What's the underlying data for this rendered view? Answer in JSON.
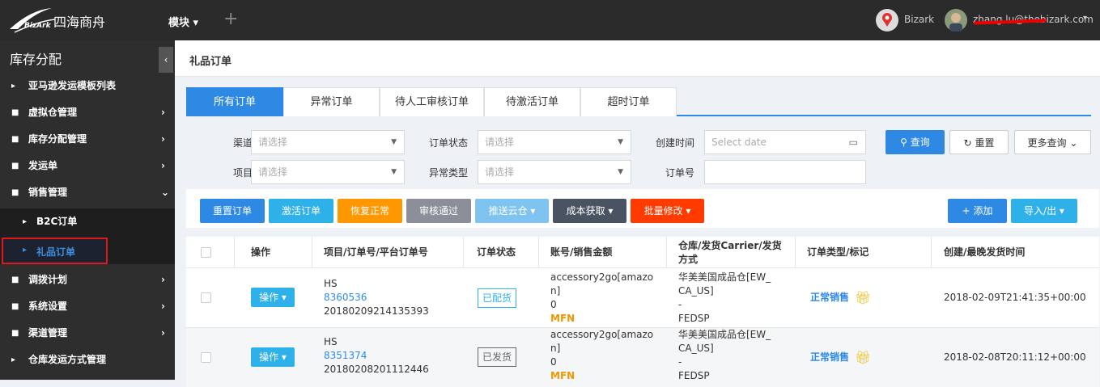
{
  "header": {
    "logo_text": "四海商舟",
    "logo_sub": "BizArk",
    "module_label": "模块",
    "plus_label": "+",
    "user1_name": "Bizark",
    "user2_email": "zhang.lu@thebizark.com"
  },
  "sidebar": {
    "title": "库存分配",
    "toggle": "‹",
    "items": [
      {
        "label": "亚马逊发运模板列表",
        "icon": "caret-right-icon",
        "arrow": ""
      },
      {
        "label": "虚拟仓管理",
        "icon": "folder-icon",
        "arrow": "›"
      },
      {
        "label": "库存分配管理",
        "icon": "folder-icon",
        "arrow": "›"
      },
      {
        "label": "发运单",
        "icon": "folder-icon",
        "arrow": "›"
      },
      {
        "label": "销售管理",
        "icon": "folder-icon",
        "arrow": "⌄"
      },
      {
        "label": "B2C订单",
        "icon": "caret-right-icon",
        "arrow": ""
      },
      {
        "label": "礼品订单",
        "icon": "caret-right-icon",
        "arrow": ""
      },
      {
        "label": "调拨计划",
        "icon": "folder-icon",
        "arrow": "›"
      },
      {
        "label": "系统设置",
        "icon": "folder-icon",
        "arrow": "›"
      },
      {
        "label": "渠道管理",
        "icon": "folder-icon",
        "arrow": "›"
      },
      {
        "label": "仓库发运方式管理",
        "icon": "caret-right-icon",
        "arrow": ""
      }
    ]
  },
  "page": {
    "title": "礼品订单"
  },
  "tabs": [
    "所有订单",
    "异常订单",
    "待人工审核订单",
    "待激活订单",
    "超时订单"
  ],
  "filters": {
    "channel_label": "渠道",
    "status_label": "订单状态",
    "created_label": "创建时间",
    "project_label": "项目",
    "exception_label": "异常类型",
    "order_no_label": "订单号",
    "select_placeholder": "请选择",
    "date_placeholder": "Select date",
    "search_btn": "查询",
    "reset_btn": "重置",
    "more_btn": "更多查询"
  },
  "toolbar": {
    "buttons": [
      "重置订单",
      "激活订单",
      "恢复正常",
      "审核通过",
      "推送云仓",
      "成本获取",
      "批量修改"
    ],
    "add_btn": "添加",
    "import_btn": "导入/出"
  },
  "colors": {
    "primary": "#2e89e5",
    "cyan": "#2eb0e8",
    "orange": "#ff9700",
    "gray": "#8a8f99",
    "dark": "#4a5361",
    "red": "#ff3b00"
  },
  "table": {
    "headers": [
      "操作",
      "项目/订单号/平台订单号",
      "订单状态",
      "账号/销售金额",
      "仓库/发货Carrier/发货方式",
      "订单类型/标记",
      "创建/最晚发货时间"
    ],
    "rows": [
      {
        "action": "操作",
        "project": "HS",
        "order_no": "8360536",
        "platform_no": "20180209214135393",
        "status": "已配货",
        "account_line1": "accessory2go[amazo",
        "account_line2": "n]",
        "amount": "0",
        "fulfil": "MFN",
        "warehouse_line1": "华美美国成品仓[EW_",
        "warehouse_line2": "CA_US]",
        "carrier": "-",
        "ship_method": "FEDSP",
        "order_type": "正常销售",
        "created_time": "2018-02-09T21:41:35+00:00"
      },
      {
        "action": "操作",
        "project": "HS",
        "order_no": "8351374",
        "platform_no": "20180208201112446",
        "status": "已发货",
        "account_line1": "accessory2go[amazo",
        "account_line2": "n]",
        "amount": "0",
        "fulfil": "MFN",
        "warehouse_line1": "华美美国成品仓[EW_",
        "warehouse_line2": "CA_US]",
        "carrier": "-",
        "ship_method": "FEDSP",
        "order_type": "正常销售",
        "created_time": "2018-02-08T20:11:12+00:00"
      }
    ]
  }
}
